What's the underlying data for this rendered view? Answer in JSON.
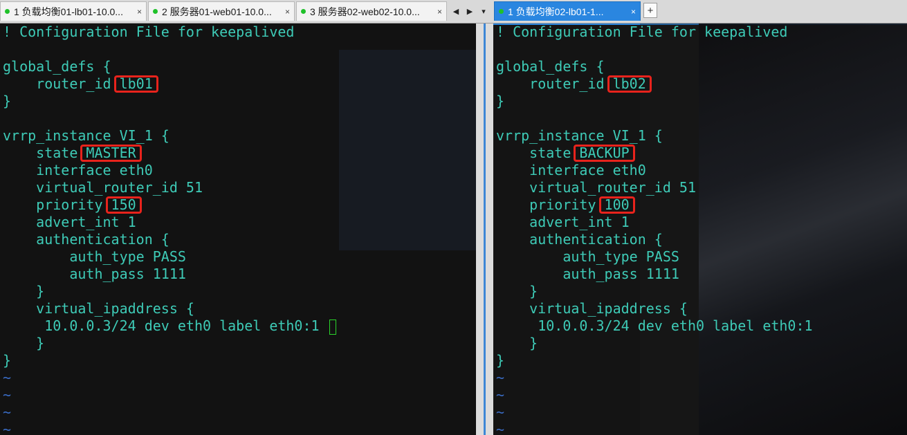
{
  "tabs": [
    {
      "label": "1 负载均衡01-lb01-10.0...",
      "close": "×",
      "active": false
    },
    {
      "label": "2 服务器01-web01-10.0...",
      "close": "×",
      "active": false
    },
    {
      "label": "3 服务器02-web02-10.0...",
      "close": "×",
      "active": false
    },
    {
      "label": "1 负载均衡02-lb01-1...",
      "close": "×",
      "active": true
    }
  ],
  "tab_nav": {
    "prev": "◀",
    "next": "▶",
    "menu": "▾",
    "add": "+"
  },
  "colors": {
    "terminal_text": "#3ecbb7",
    "tilde": "#3a6cc5",
    "highlight_box": "#e8231c",
    "active_tab": "#2a86e0",
    "cursor": "#2bd62b"
  },
  "left_pane": {
    "lines": [
      "! Configuration File for keepalived",
      "",
      "global_defs {",
      "    router_id ",
      "}",
      "",
      "vrrp_instance VI_1 {",
      "    state ",
      "    interface eth0",
      "    virtual_router_id 51",
      "    priority ",
      "    advert_int 1",
      "    authentication {",
      "        auth_type PASS",
      "        auth_pass 1111",
      "    }",
      "    virtual_ipaddress {",
      "     10.0.0.3/24 dev eth0 label eth0:1",
      "    }",
      "}",
      "~",
      "~",
      "~",
      "~"
    ],
    "router_id": "lb01",
    "state": "MASTER",
    "priority": "150"
  },
  "right_pane": {
    "lines": [
      "! Configuration File for keepalived",
      "",
      "global_defs {",
      "    router_id ",
      "}",
      "",
      "vrrp_instance VI_1 {",
      "    state ",
      "    interface eth0",
      "    virtual_router_id 51",
      "    priority ",
      "    advert_int 1",
      "    authentication {",
      "        auth_type PASS",
      "        auth_pass 1111",
      "    }",
      "    virtual_ipaddress {",
      "     10.0.0.3/24 dev eth0 label eth0:1",
      "    }",
      "}",
      "~",
      "~",
      "~",
      "~"
    ],
    "router_id": "lb02",
    "state": "BACKUP",
    "priority": "100"
  }
}
